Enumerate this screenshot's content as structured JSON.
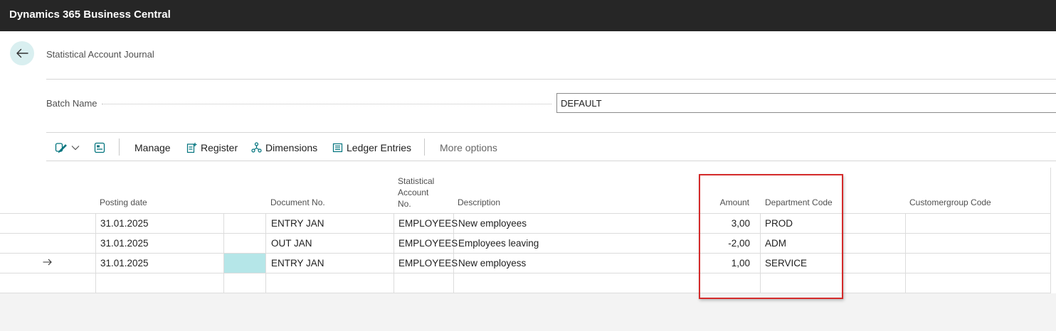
{
  "app": {
    "title": "Dynamics 365 Business Central"
  },
  "page": {
    "title": "Statistical Account Journal"
  },
  "batch": {
    "label": "Batch Name",
    "value": "DEFAULT"
  },
  "actions": {
    "manage": "Manage",
    "register": "Register",
    "dimensions": "Dimensions",
    "ledger_entries": "Ledger Entries",
    "more_options": "More options"
  },
  "columns": {
    "posting_date": "Posting date",
    "document_no": "Document No.",
    "stat_account_line1": "Statistical",
    "stat_account_line2": "Account",
    "stat_account_line3": "No.",
    "description": "Description",
    "amount": "Amount",
    "department_code": "Department Code",
    "customergroup_code": "Customergroup Code"
  },
  "rows": [
    {
      "posting_date": "31.01.2025",
      "document_no": "ENTRY JAN",
      "account_no": "EMPLOYEES",
      "description": "New employees",
      "amount": "3,00",
      "department_code": "PROD",
      "customergroup_code": ""
    },
    {
      "posting_date": "31.01.2025",
      "document_no": "OUT JAN",
      "account_no": "EMPLOYEES",
      "description": "Employees leaving",
      "amount": "-2,00",
      "department_code": "ADM",
      "customergroup_code": ""
    },
    {
      "posting_date": "31.01.2025",
      "document_no": "ENTRY JAN",
      "account_no": "EMPLOYEES",
      "description": "New employess",
      "amount": "1,00",
      "department_code": "SERVICE",
      "customergroup_code": ""
    }
  ],
  "colors": {
    "accent": "#00737d",
    "top_bar": "#262626",
    "selected_cell": "#b5e6e8",
    "annotation": "#d42a2a"
  }
}
